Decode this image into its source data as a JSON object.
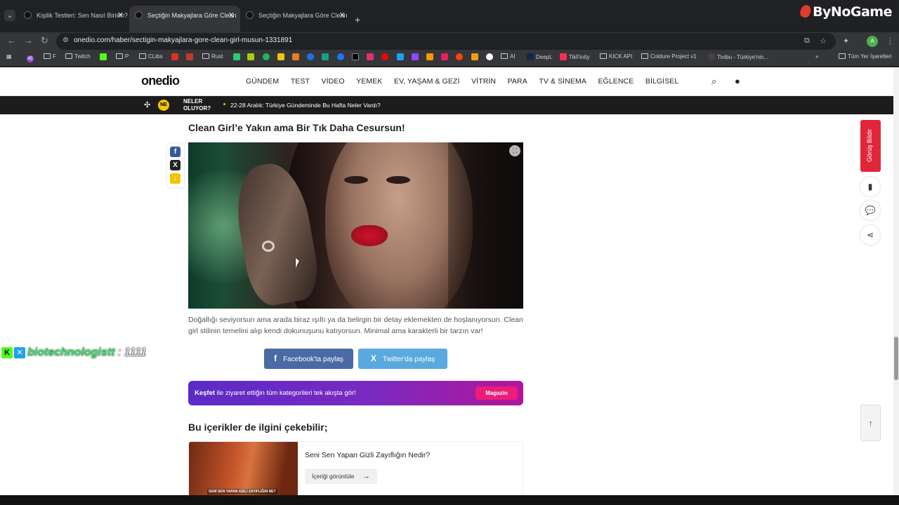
{
  "browser": {
    "tabs": [
      {
        "title": "Kişilik Testleri: Sen Nasıl Birisin?",
        "active": false
      },
      {
        "title": "Seçtiğin Makyajlara Göre Clean",
        "active": true
      },
      {
        "title": "Seçtiğin Makyajlara Göre Clean",
        "active": false
      }
    ],
    "new_tab": "+",
    "url": "onedio.com/haber/sectigin-makyajlara-gore-clean-girl-musun-1331891",
    "profile_initial": "A",
    "bookmarks": [
      {
        "label": "F",
        "type": "folder"
      },
      {
        "label": "Twitch",
        "type": "folder"
      },
      {
        "label": "P",
        "type": "folder"
      },
      {
        "label": "CLibs",
        "type": "folder"
      },
      {
        "label": "Rust",
        "type": "folder"
      },
      {
        "label": "AI",
        "type": "folder"
      },
      {
        "label": "DeepL",
        "type": "site"
      },
      {
        "label": "TikFinity",
        "type": "site"
      },
      {
        "label": "KICK API",
        "type": "folder"
      },
      {
        "label": "Coldure Project v1",
        "type": "folder"
      },
      {
        "label": "Tivibu - Türkiye'nin...",
        "type": "site"
      }
    ],
    "all_bookmarks": "Tüm Yer İşaretleri",
    "bookmark_badge": "45"
  },
  "stream_brand": "ByNoGame",
  "site": {
    "logo": "onedio",
    "nav": [
      "GÜNDEM",
      "TEST",
      "VİDEO",
      "YEMEK",
      "EV, YAŞAM & GEZİ",
      "VİTRİN",
      "PARA",
      "TV & SİNEMA",
      "EĞLENCE",
      "BİLGİSEL"
    ],
    "ticker_badge": "NE",
    "ticker_label": "NELER OLUYOR?",
    "ticker_text": "22-28 Aralık: Türkiye Gündeminde Bu Hafta Neler Vardı?"
  },
  "article": {
    "title": "Clean Girl’e Yakın ama Bir Tık Daha Cesursun!",
    "description": "Doğallığı seviyorsun ama arada biraz ışıltı ya da belirgin bir detay eklemekten de hoşlanıyorsun. Clean girl stilinin temelini alıp kendi dokunuşunu katıyorsun. Minimal ama karakterli bir tarzın var!",
    "share_facebook": "Facebook'ta paylaş",
    "share_twitter": "Twitter'da paylaş"
  },
  "discover": {
    "bold": "Keşfet",
    "text": " ile ziyaret ettiğin tüm kategorileri tek akışta gör!",
    "pill": "Magazin"
  },
  "related": {
    "heading": "Bu içerikler de ilgini çekebilir;",
    "items": [
      {
        "title": "Seni Sen Yapan Gizli Zayıflığın Nedir?",
        "thumb_caption": "SENİ SEN YAPAN GİZLİ ZAYIFLIĞIN NE?",
        "button": "İçeriği görüntüle"
      }
    ]
  },
  "sidebar": {
    "feedback": "Görüş Bildir"
  },
  "overlay": {
    "user": "biotechnologistt",
    "message": " : 1111"
  },
  "colors": {
    "facebook": "#4a6aa5",
    "twitter": "#5aa9de",
    "feedback": "#e2263a",
    "ticker_bg": "#1c1c1c",
    "kick_green": "#53fc18"
  }
}
